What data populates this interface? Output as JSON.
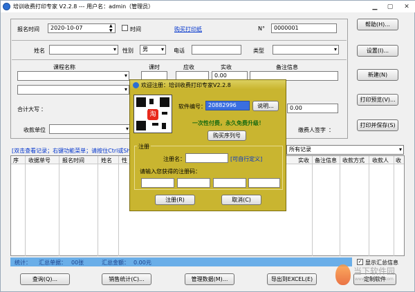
{
  "window": {
    "title": "培训收费打印专家 V2.2.8 --- 用户名：admin（管理员）"
  },
  "form": {
    "date_label": "报名时间",
    "date_value": "2020-10-07",
    "time_label": "时间",
    "buy_paper_link": "购买打印纸",
    "no_label": "N°",
    "no_value": "0000001",
    "name_label": "姓名",
    "gender_label": "性别",
    "gender_value": "男",
    "phone_label": "电话",
    "type_label": "类型",
    "course_header": "课程名称",
    "hours_header": "课时",
    "due_header": "应收",
    "paid_header": "实收",
    "paid_value": "0.00",
    "remark_header": "备注信息",
    "total_upper_label": "合计大写",
    "total_value": "0.00",
    "unit_label": "收款单位",
    "signer_label": "缴费人签字"
  },
  "side_buttons": [
    "帮助(H)...",
    "设置(I)...",
    "新建(N)",
    "打印预览(V)...",
    "打印并保存(S)"
  ],
  "records": {
    "hint": "[双击查看记录；右键功能菜单；请按住Ctrl或Shift键",
    "filter_value": "所有记录",
    "columns": [
      "序",
      "收据单号",
      "报名时间",
      "姓名",
      "性",
      "实收",
      "备注信息",
      "收款方式",
      "收款人",
      "收"
    ]
  },
  "stats": {
    "prefix": "统计：",
    "count_label": "汇总单据：",
    "count_value": "00张",
    "amount_label": "汇总金额：",
    "amount_value": "0.00元"
  },
  "show_summary": "显示汇总信息",
  "bottom_buttons": [
    "查询(Q)...",
    "销售统计(C)...",
    "管理数据(M)...",
    "导出到EXCEL(E)",
    "定制软件"
  ],
  "dialog": {
    "title": "欢迎注册：培训收费打印专家V2.2.8",
    "serial_label": "软件编号：",
    "serial_value": "20882996",
    "explain_button": "说明...",
    "slogan": "一次性付费，永久免费升级！",
    "buy_serial_button": "购买序列号",
    "register_group": "注册",
    "reg_name_label": "注册名：",
    "custom_hint": "[可自行定义]",
    "code_prompt": "请输入您获得的注册码：",
    "register_button": "注册(R)",
    "cancel_button": "取消(C)"
  },
  "watermark": {
    "text": "当下软件园",
    "sub": "www.downxia.com"
  },
  "colors": {
    "stats_bar": "#6aaee8",
    "dialog_bg": "#c9b530",
    "slogan": "#1a6b10",
    "link": "#0033cc"
  }
}
